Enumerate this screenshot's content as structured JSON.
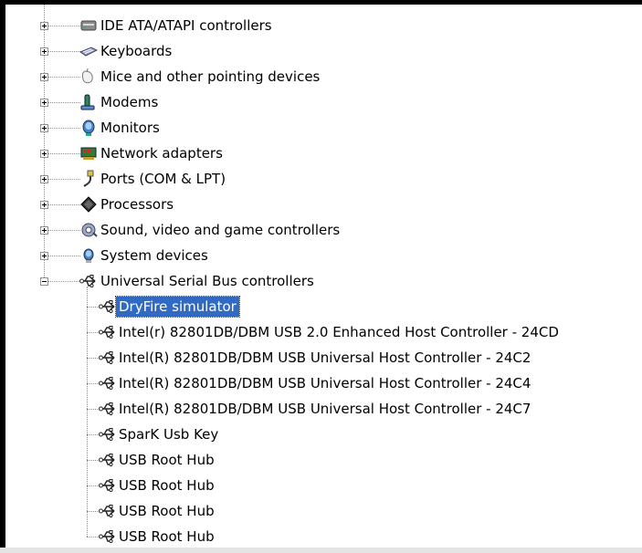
{
  "categories": [
    {
      "label": "IDE ATA/ATAPI controllers",
      "icon": "ide-controller-icon",
      "expanded": false
    },
    {
      "label": "Keyboards",
      "icon": "keyboard-icon",
      "expanded": false
    },
    {
      "label": "Mice and other pointing devices",
      "icon": "mouse-icon",
      "expanded": false
    },
    {
      "label": "Modems",
      "icon": "modem-icon",
      "expanded": false
    },
    {
      "label": "Monitors",
      "icon": "monitor-icon",
      "expanded": false
    },
    {
      "label": "Network adapters",
      "icon": "network-adapter-icon",
      "expanded": false
    },
    {
      "label": "Ports (COM & LPT)",
      "icon": "port-icon",
      "expanded": false
    },
    {
      "label": "Processors",
      "icon": "processor-icon",
      "expanded": false
    },
    {
      "label": "Sound, video and game controllers",
      "icon": "sound-icon",
      "expanded": false
    },
    {
      "label": "System devices",
      "icon": "system-device-icon",
      "expanded": false
    },
    {
      "label": "Universal Serial Bus controllers",
      "icon": "usb-icon",
      "expanded": true
    }
  ],
  "usb_devices": [
    {
      "label": "DryFire simulator",
      "icon": "usb-icon",
      "selected": true
    },
    {
      "label": "Intel(r) 82801DB/DBM USB 2.0 Enhanced Host Controller - 24CD",
      "icon": "usb-icon"
    },
    {
      "label": "Intel(R) 82801DB/DBM USB Universal Host Controller - 24C2",
      "icon": "usb-icon"
    },
    {
      "label": "Intel(R) 82801DB/DBM USB Universal Host Controller - 24C4",
      "icon": "usb-icon"
    },
    {
      "label": "Intel(R) 82801DB/DBM USB Universal Host Controller - 24C7",
      "icon": "usb-icon"
    },
    {
      "label": "SparK Usb Key",
      "icon": "usb-icon"
    },
    {
      "label": "USB Root Hub",
      "icon": "usb-icon"
    },
    {
      "label": "USB Root Hub",
      "icon": "usb-icon"
    },
    {
      "label": "USB Root Hub",
      "icon": "usb-icon"
    },
    {
      "label": "USB Root Hub",
      "icon": "usb-icon"
    }
  ],
  "colors": {
    "selection": "#316ac5",
    "tree_lines": "#8f8f8f"
  }
}
